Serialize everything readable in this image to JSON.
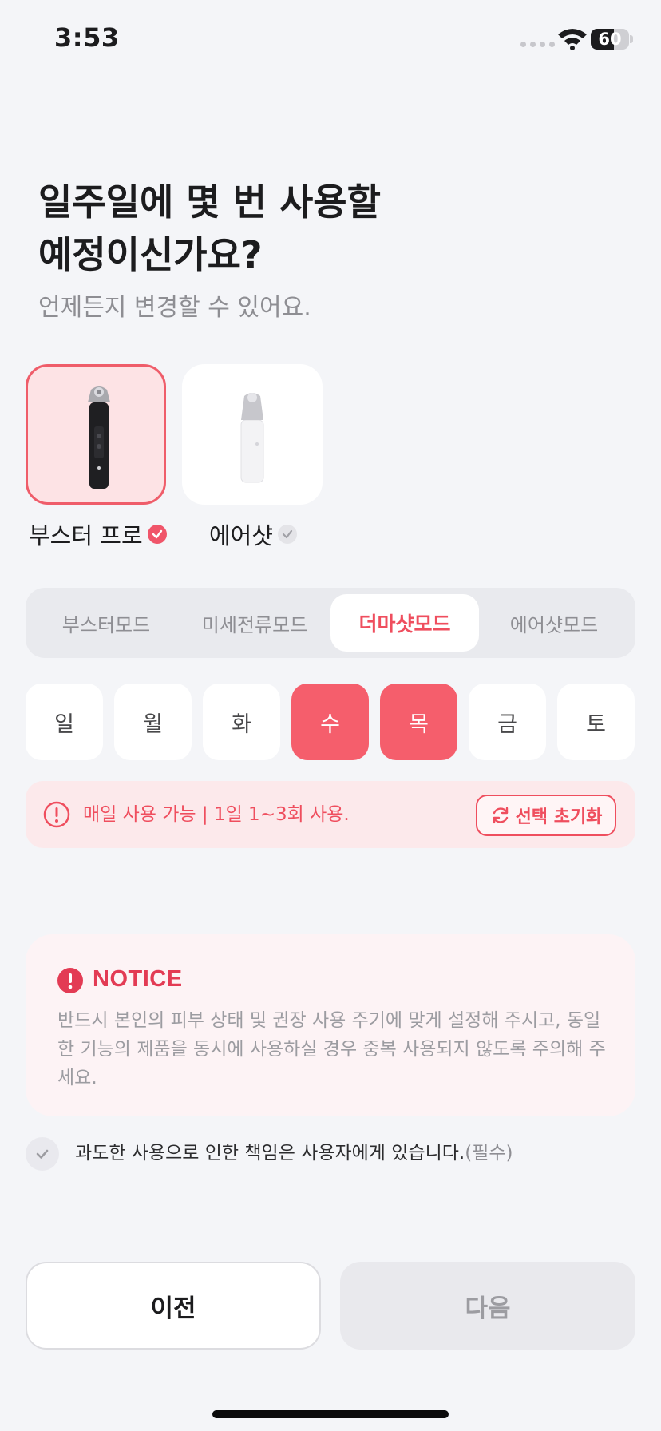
{
  "status_bar": {
    "time": "3:53",
    "battery": "60",
    "battery_level": 0.6
  },
  "header": {
    "title": "일주일에 몇 번 사용할\n예정이신가요?",
    "subtitle": "언제든지 변경할 수 있어요."
  },
  "devices": [
    {
      "name": "부스터 프로",
      "selected": true,
      "image": "booster-pro-device"
    },
    {
      "name": "에어샷",
      "selected": false,
      "image": "airshot-device"
    }
  ],
  "modes": [
    {
      "label": "부스터모드",
      "active": false
    },
    {
      "label": "미세전류모드",
      "active": false
    },
    {
      "label": "더마샷모드",
      "active": true
    },
    {
      "label": "에어샷모드",
      "active": false
    }
  ],
  "days": [
    {
      "label": "일",
      "selected": false
    },
    {
      "label": "월",
      "selected": false
    },
    {
      "label": "화",
      "selected": false
    },
    {
      "label": "수",
      "selected": true
    },
    {
      "label": "목",
      "selected": true
    },
    {
      "label": "금",
      "selected": false
    },
    {
      "label": "토",
      "selected": false
    }
  ],
  "info": {
    "text": "매일 사용 가능 | 1일 1~3회 사용.",
    "reset_label": "선택 초기화",
    "icon": "alert-circle-icon"
  },
  "notice": {
    "title": "NOTICE",
    "body": "반드시 본인의 피부 상태 및 권장 사용 주기에 맞게 설정해 주시고, 동일한 기능의 제품을 동시에 사용하실 경우 중복 사용되지 않도록 주의해 주세요."
  },
  "agreement": {
    "text": "과도한 사용으로 인한 책임은 사용자에게 있습니다.",
    "required": "(필수)",
    "checked": false
  },
  "buttons": {
    "prev": "이전",
    "next": "다음"
  },
  "colors": {
    "accent": "#f55e6c",
    "accent_text": "#ef4e5e",
    "notice": "#e33b54",
    "background": "#f4f5f8"
  }
}
